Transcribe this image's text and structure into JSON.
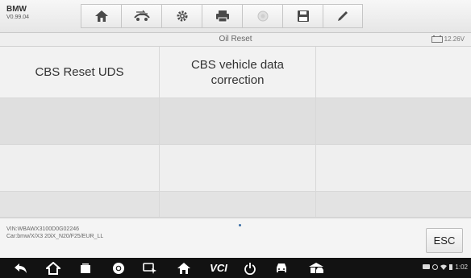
{
  "app": {
    "make": "BMW",
    "version": "V0.99.04"
  },
  "toolbar": {
    "icons": [
      "home-icon",
      "vehicle-swap-icon",
      "settings-icon",
      "print-icon",
      "help-icon",
      "save-icon",
      "edit-icon"
    ]
  },
  "page": {
    "title": "Oil Reset",
    "battery": "12.26V"
  },
  "grid": {
    "rows": [
      [
        "CBS Reset UDS",
        "CBS vehicle data correction",
        ""
      ],
      [
        "",
        "",
        ""
      ],
      [
        "",
        "",
        ""
      ],
      [
        "",
        "",
        ""
      ]
    ]
  },
  "vehicle": {
    "vin": "VIN:WBAWX3100D0G02246",
    "car": "Car:bmw/X/X3 20iX_N20/F25/EUR_LL"
  },
  "esc_label": "ESC",
  "navbar": {
    "icons": [
      "back-icon",
      "home-icon",
      "recent-apps-icon",
      "chrome-icon",
      "remote-icon",
      "autel-home-icon",
      "vci-icon",
      "power-icon",
      "car-icon",
      "shop-icon"
    ],
    "vcl_label": "VCI",
    "time": "1:02"
  },
  "colors": {
    "accent": "#3a6ea5",
    "navbar": "#121212"
  }
}
